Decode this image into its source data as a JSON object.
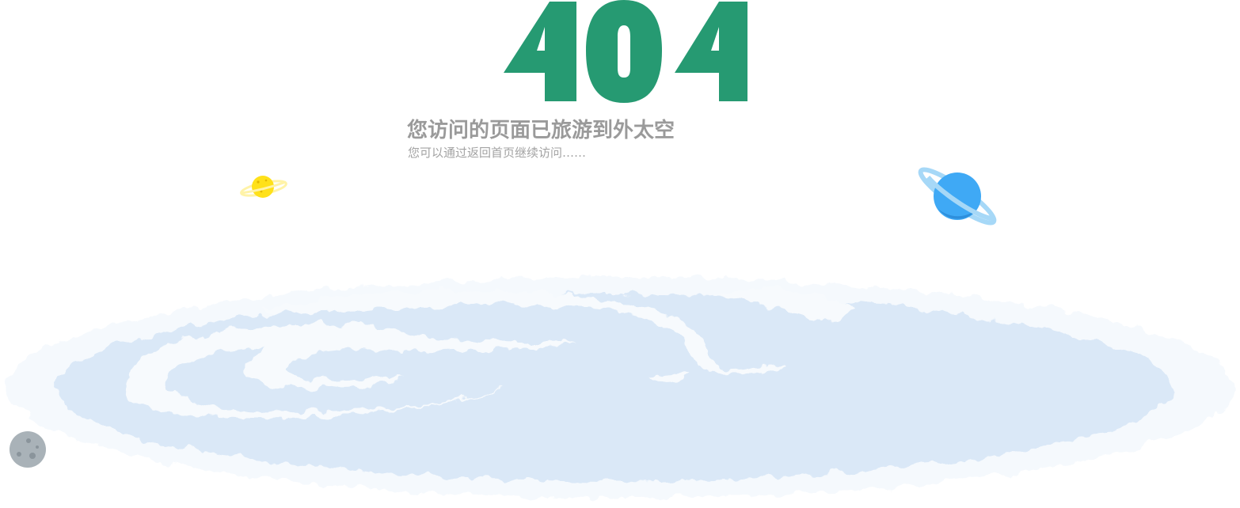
{
  "error_page": {
    "code": "404",
    "headline": "您访问的页面已旅游到外太空",
    "subline": "您可以通过返回首页继续访问……"
  },
  "colors": {
    "code": "#269a72",
    "headline": "#9a9a9a",
    "subline": "#a3a3a3",
    "ground": "#dae8f7",
    "ground_highlight": "#f5f9fd",
    "planet_yellow": "#ffe11a",
    "planet_blue": "#3fa9f5",
    "moon": "#a9b2b8"
  },
  "icons": {
    "yellow_planet": "ringed-planet-icon",
    "blue_planet": "ringed-planet-icon",
    "moon": "moon-icon"
  }
}
